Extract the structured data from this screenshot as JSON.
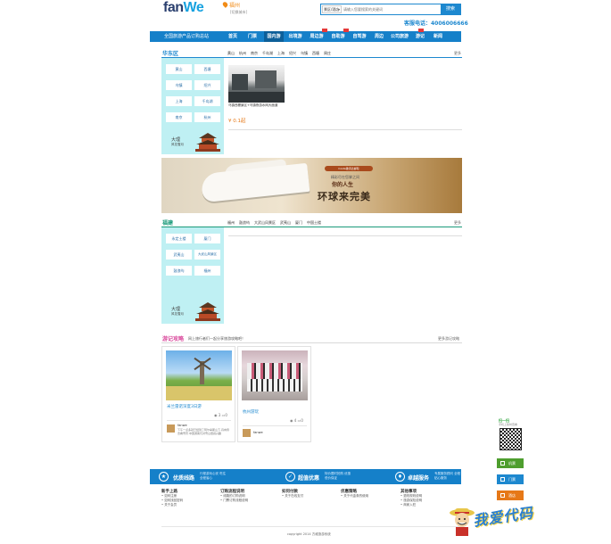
{
  "header": {
    "logo_main": "fan",
    "logo_accent": "We",
    "city": "福州",
    "city_switch": "[切换城市]",
    "search_type": "景区/酒店",
    "search_placeholder": "请输入您要搜索的关键词",
    "search_button": "搜索",
    "hotline": "客服电话：4006006666"
  },
  "nav": {
    "tagline": "全国旅游产品订购总站",
    "items": [
      "首页",
      "门票",
      "国内游",
      "出境游",
      "周边游",
      "自助游",
      "自驾游",
      "周边",
      "公司旅游",
      "游记",
      "新闻"
    ]
  },
  "section_east": {
    "title": "华东区",
    "tabs": [
      "黄山",
      "杭州",
      "南京",
      "千岛湖",
      "上海",
      "绍兴",
      "乌镇",
      "西塘",
      "周庄"
    ],
    "more": "更多",
    "chips": [
      "黄山",
      "西塘",
      "乌镇",
      "绍兴",
      "上海",
      "千岛湖",
      "南京",
      "杭州"
    ],
    "side_text_1": "大理",
    "side_text_2": "风花雪月",
    "product_caption": "乌镇西栅景区+乌镇夜游水网大面道",
    "product_price": "¥ 0.1起"
  },
  "banner": {
    "tag": "Costa歌诗达邮轮",
    "sub_heading": "精彩尽在您掌之间",
    "tagline": "你的人生",
    "headline": "环球来完美"
  },
  "section_fujian": {
    "title": "福建",
    "tabs": [
      "福州",
      "鼓浪屿",
      "大武山风景区",
      "武夷山",
      "厦门",
      "中国土楼"
    ],
    "more": "更多",
    "chips": [
      "永定土楼",
      "厦门",
      "武夷山",
      "大武山风景区",
      "鼓浪屿",
      "福州"
    ],
    "side_text_1": "大理",
    "side_text_2": "风花雪月"
  },
  "section_travel": {
    "title": "游记攻略",
    "subtitle": "网上旅行者们一起分享旅游攻略吧！",
    "more": "更多游记攻略",
    "cards": [
      {
        "title": "米兰雷诺深度3日游",
        "views": "3",
        "comments": "0",
        "author": "fanwe",
        "excerpt": "下午一点多就已经到了阿尔卑斯山下·丹向导去看雪景·中国游客们对雪山很感兴趣"
      },
      {
        "title": "杭州游玩",
        "views": "4",
        "comments": "0",
        "author": "fanwe",
        "excerpt": ""
      }
    ]
  },
  "footer": {
    "band": [
      {
        "icon": "★",
        "title": "优质线路",
        "desc": "行程游玩心安 吃住全程省心"
      },
      {
        "icon": "✓",
        "title": "超值优惠",
        "desc": "特价限时抢购 优惠低价保证"
      },
      {
        "icon": "♦",
        "title": "卓越服务",
        "desc": "专属服务顾问 全程贴心服务"
      }
    ],
    "columns": [
      {
        "head": "新手上路",
        "items": [
          "如何注册",
          "如何找回密码",
          "关于会员"
        ]
      },
      {
        "head": "订购流程说明",
        "items": [
          "线路的订购说明",
          "门票订购流程说明"
        ]
      },
      {
        "head": "如何付款",
        "items": [
          "关于在线支付"
        ]
      },
      {
        "head": "优惠策略",
        "items": [
          "关于代金券的使用"
        ]
      },
      {
        "head": "其他事项",
        "items": [
          "退改规则说明",
          "旅游保险说明",
          "商家入驻"
        ]
      }
    ],
    "copyright": "copyright 2014 方维旅游系统"
  },
  "float_panel": {
    "qr_label": "扫一扫",
    "qr_sub": "手机上随时查看",
    "items": [
      "机票",
      "门票",
      "酒店"
    ]
  },
  "watermark": "我爱代码"
}
